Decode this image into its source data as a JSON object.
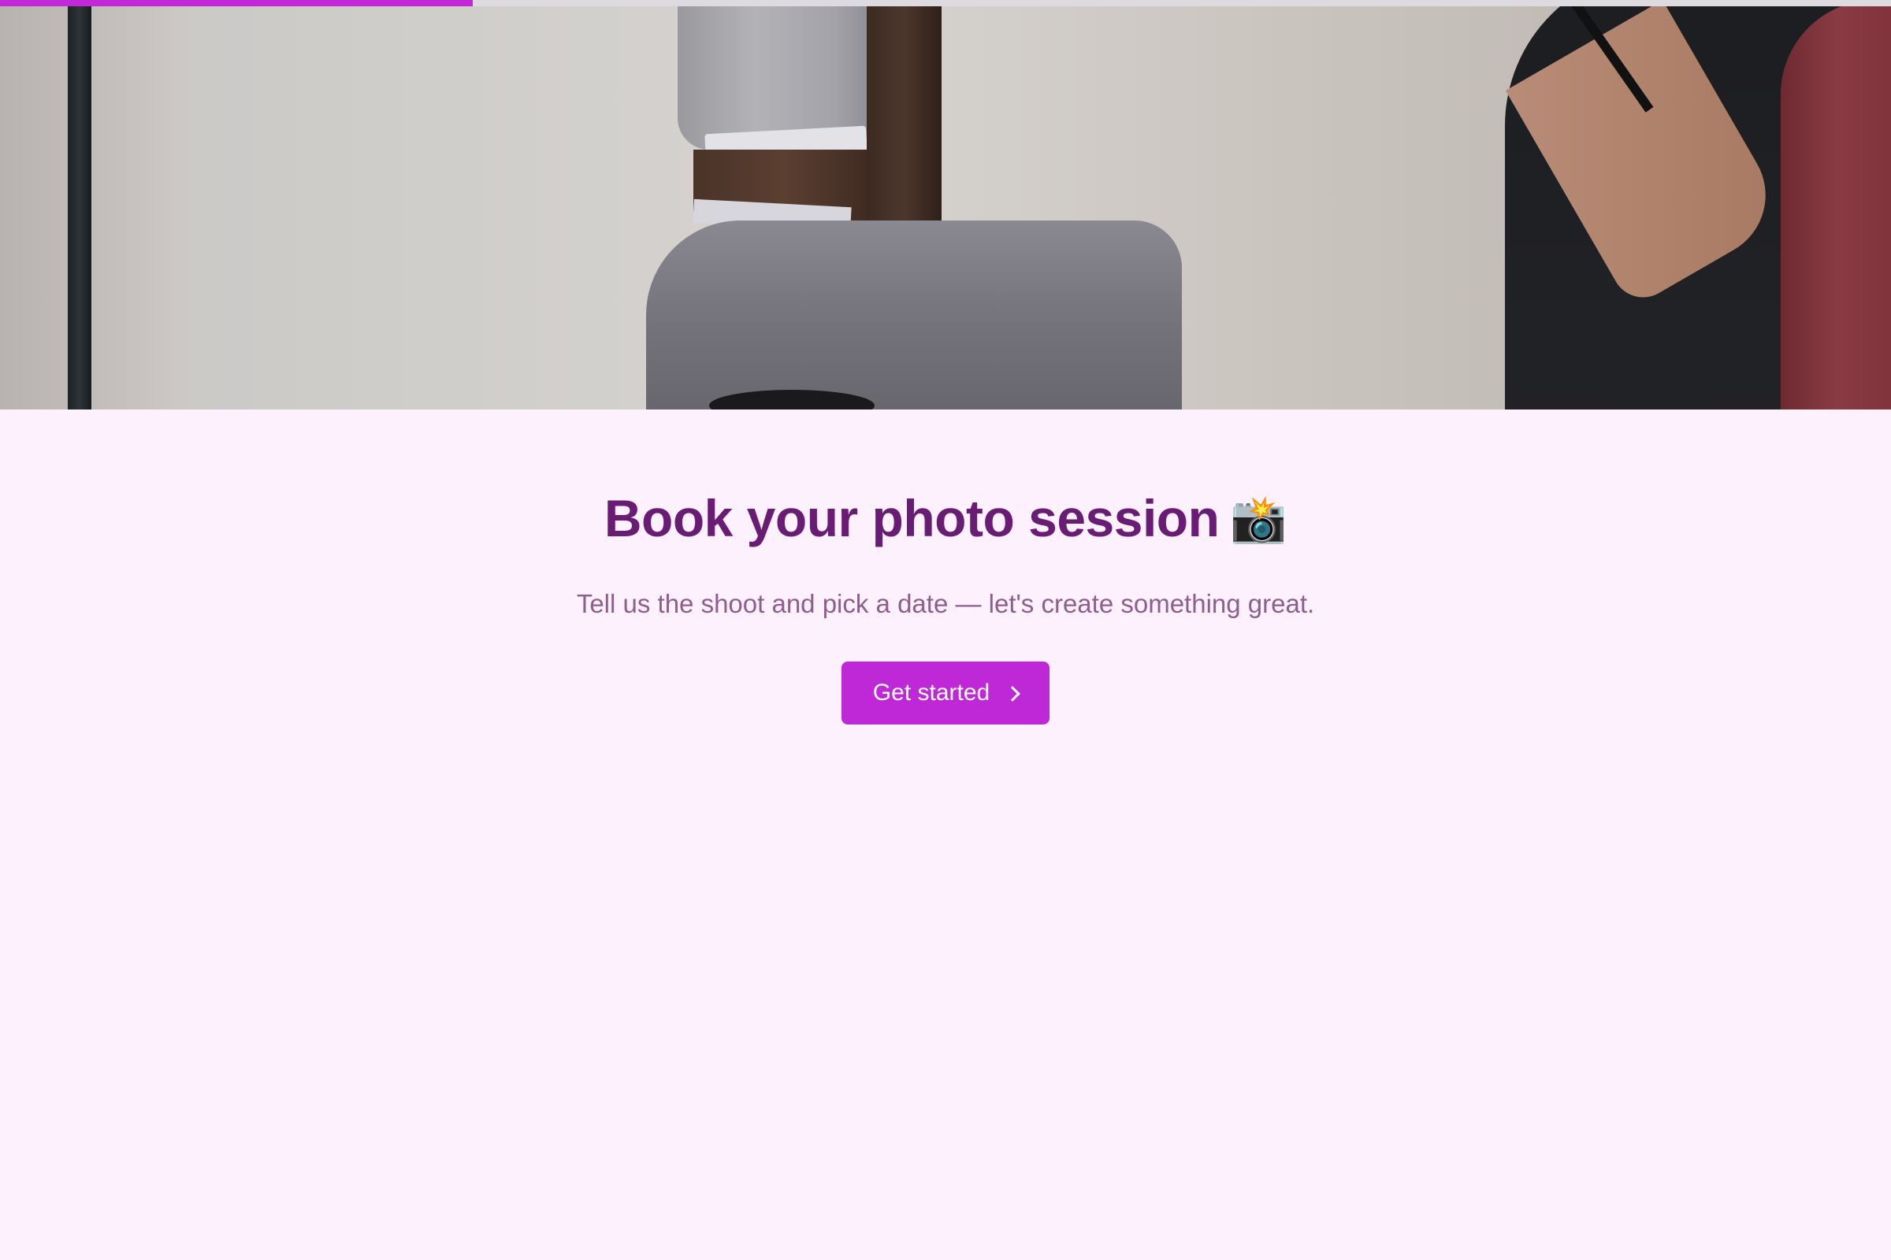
{
  "progress": {
    "value_percent": 25,
    "fill_color": "#c128d8"
  },
  "hero": {
    "icon": "photo-studio-image"
  },
  "header": {
    "title": "Book your photo session",
    "title_emoji": "📸",
    "subtitle": "Tell us the shoot and pick a date — let's create something great."
  },
  "cta": {
    "label": "Get started",
    "icon": "chevron-right-icon",
    "color": "#bf28d6"
  },
  "colors": {
    "background": "#fdf1fd",
    "title": "#681c74",
    "subtitle": "#8d5e8e"
  }
}
